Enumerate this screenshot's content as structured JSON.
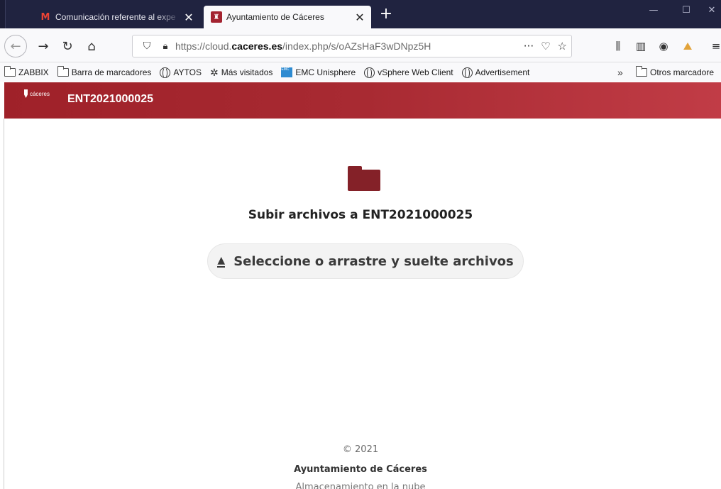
{
  "browser": {
    "tabs": [
      {
        "title": "Comunicación referente al expe",
        "icon": "gmail-icon",
        "active": false
      },
      {
        "title": "Ayuntamiento de Cáceres",
        "icon": "caceres-crest-icon",
        "active": true
      }
    ],
    "new_tab": "+",
    "tab_close": "✕",
    "url_prefix": "https://cloud.",
    "url_domain": "caceres.es",
    "url_path": "/index.php/s/oAZsHaF3wDNpz5H",
    "url_more": "···",
    "bookmarks": [
      {
        "label": "ZABBIX",
        "icon": "folder-icon"
      },
      {
        "label": "Barra de marcadores",
        "icon": "folder-icon"
      },
      {
        "label": "AYTOS",
        "icon": "globe-icon"
      },
      {
        "label": "Más visitados",
        "icon": "gear-icon"
      },
      {
        "label": "EMC Unisphere",
        "icon": "emc-icon"
      },
      {
        "label": "vSphere Web Client",
        "icon": "globe-icon"
      },
      {
        "label": "Advertisement",
        "icon": "globe-icon"
      }
    ],
    "bookmarks_overflow": "»",
    "other_bookmarks": "Otros marcadore"
  },
  "app": {
    "logo_text": "cáceres",
    "header_title": "ENT2021000025",
    "upload_title": "Subir archivos a ENT2021000025",
    "select_button_label": "Seleccione o arrastre y suelte archivos",
    "accent_color": "#a4262f",
    "folder_color": "#842128"
  },
  "footer": {
    "copyright": "© 2021",
    "organization": "Ayuntamiento de Cáceres",
    "subtitle": "Almacenamiento en la nube"
  }
}
